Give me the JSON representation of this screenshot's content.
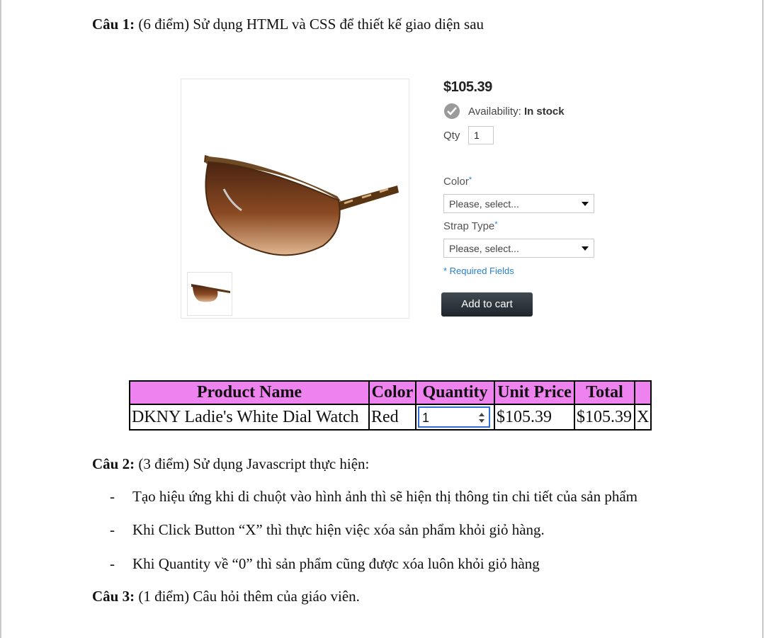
{
  "questions": {
    "q1": {
      "label": "Câu 1:",
      "text": " (6 điểm) Sử dụng HTML và CSS để thiết kế giao diện sau"
    },
    "q2": {
      "label": "Câu 2:",
      "text": " (3 điểm) Sử dụng Javascript thực hiện:"
    },
    "q3": {
      "label": "Câu 3:",
      "text": " (1 điểm) Câu hỏi thêm của giáo viên."
    }
  },
  "bullets": [
    {
      "dash": "-",
      "text": "Tạo hiệu ứng khi di chuột vào hình ảnh thì sẽ hiện thị thông tin chi tiết của sản phẩm"
    },
    {
      "dash": "-",
      "text": "Khi Click Button “X” thì thực hiện việc xóa sản phẩm khỏi giỏ hàng."
    },
    {
      "dash": "-",
      "text": "Khi Quantity về “0” thì sản phẩm cũng được xóa luôn khỏi giỏ hàng"
    }
  ],
  "product": {
    "price": "$105.39",
    "availability_label": "Availability:",
    "availability_value": "In stock",
    "qty_label": "Qty",
    "qty_value": "1",
    "color_label": "Color",
    "strap_label": "Strap Type",
    "required_mark": "*",
    "select_placeholder": "Please, select...",
    "required_note": "* Required Fields",
    "add_to_cart": "Add to cart",
    "image_icon": "sunglasses-image",
    "lens_color": "#8a4a22",
    "button_color": "#2b3339"
  },
  "cart": {
    "header_color": "#ee82ee",
    "headers": [
      "Product Name",
      "Color",
      "Quantity",
      "Unit Price",
      "Total",
      ""
    ],
    "row": {
      "name": "DKNY Ladie's White Dial Watch",
      "color": "Red",
      "quantity": "1",
      "unit_price": "$105.39",
      "total": "$105.39",
      "remove": "X"
    }
  }
}
